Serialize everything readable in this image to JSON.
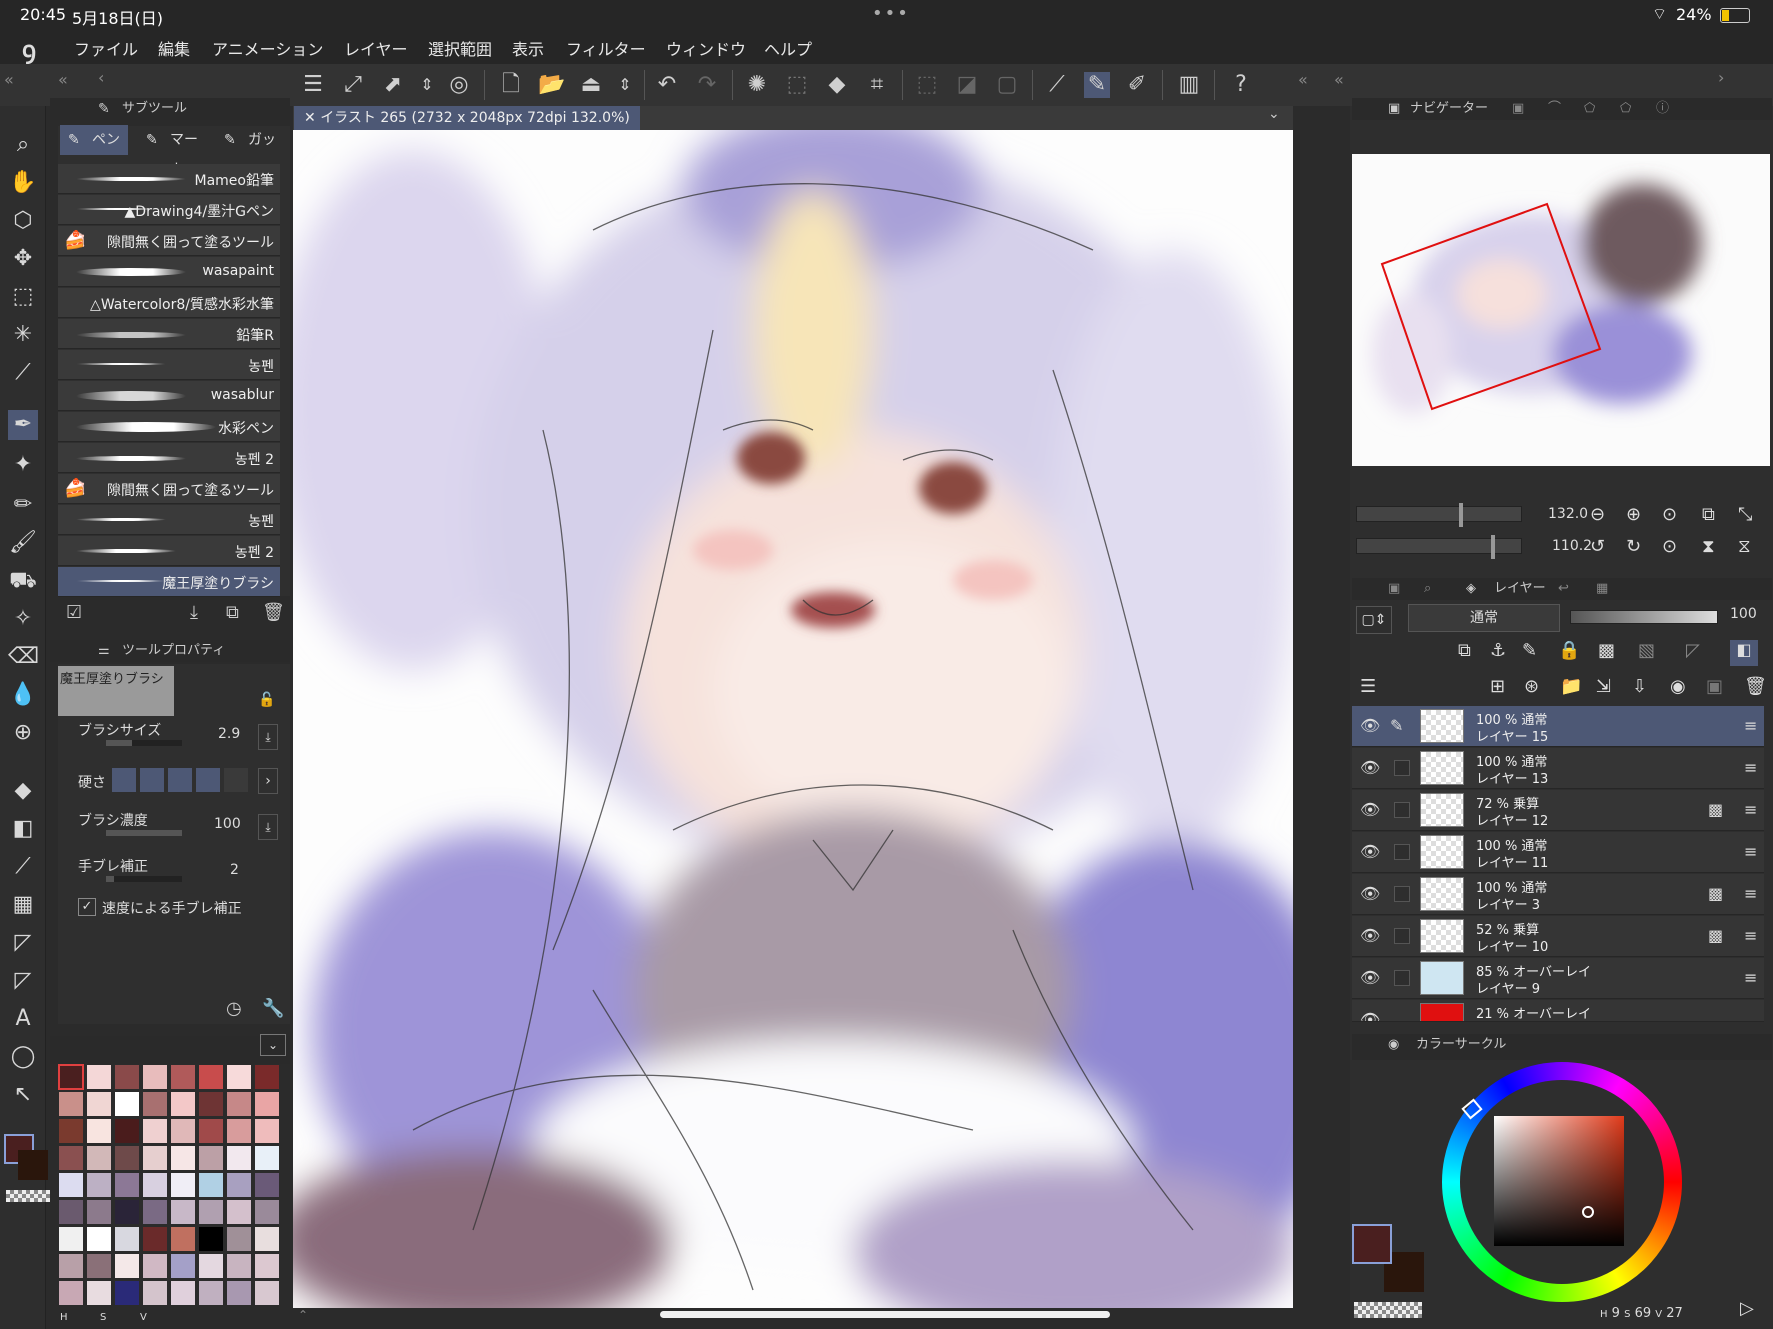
{
  "status": {
    "time": "20:45",
    "date": "5月18日(日)",
    "battery": "24%",
    "dots": "•••"
  },
  "menu": [
    "ファイル",
    "編集",
    "アニメーション",
    "レイヤー",
    "選択範囲",
    "表示",
    "フィルター",
    "ウィンドウ",
    "ヘルプ"
  ],
  "document_tab": "イラスト 265 (2732 x 2048px 72dpi 132.0%)",
  "subtool_panel": {
    "title": "サブツール",
    "tabs": [
      "ペン",
      "マーカ",
      "ガッシ"
    ],
    "brushes": [
      "Mameo鉛筆",
      "▲Drawing4/墨汁Gペン",
      "隙間無く囲って塗るツール",
      "wasapaint",
      "△Watercolor8/質感水彩水筆",
      "鉛筆R",
      "농펜",
      "wasablur",
      "水彩ペン",
      "농펜 2",
      "隙間無く囲って塗るツール",
      "농펜",
      "농펜 2",
      "魔王厚塗りブラシ"
    ]
  },
  "tool_property": {
    "title": "ツールプロパティ",
    "preset": "魔王厚塗りブラシ",
    "brush_size_label": "ブラシサイズ",
    "brush_size": "2.9",
    "hardness_label": "硬さ",
    "density_label": "ブラシ濃度",
    "density": "100",
    "stabilization_label": "手ブレ補正",
    "stabilization": "2",
    "speed_stab_label": "速度による手ブレ補正"
  },
  "palette_footer": [
    "H",
    "S",
    "V"
  ],
  "palette_colors": [
    "#4a1f1f",
    "#f4d7d7",
    "#8a4a4a",
    "#e8bcbc",
    "#b05a5a",
    "#c84c4c",
    "#f7dada",
    "#7a2a2a",
    "#c9908a",
    "#f0d6d3",
    "#ffffff",
    "#a87070",
    "#f3c8c8",
    "#6e3434",
    "#c68888",
    "#e9a5a5",
    "#7a3a2e",
    "#f8e4e0",
    "#4a1c1c",
    "#efd0d0",
    "#e0b8b8",
    "#a04a4a",
    "#d89c9c",
    "#efbcbc",
    "#8a5050",
    "#d2b8b8",
    "#6e4a4a",
    "#e6cfcf",
    "#f6e6e6",
    "#bca0a6",
    "#f2e8ee",
    "#e8f0f8",
    "#dcdcf0",
    "#bcb0c4",
    "#8c7896",
    "#d8d0e0",
    "#f0eef6",
    "#b0d0e4",
    "#a8a0c0",
    "#6a5a78",
    "#6a5a6e",
    "#8c7a8c",
    "#2a2438",
    "#7a6a84",
    "#c8b8c8",
    "#b0a0b0",
    "#d4c0cc",
    "#9a8a9a",
    "#f0f0f0",
    "#ffffff",
    "#d8d8e0",
    "#6a2a2a",
    "#c07060",
    "#000000",
    "#a09098",
    "#e8dede",
    "#b8a0a8",
    "#8a7078",
    "#f4e8e8",
    "#d0b8c4",
    "#a4a0c8",
    "#e4d8e0",
    "#c8b4c0",
    "#dcc8d0",
    "#c8a8b4",
    "#e8dce0",
    "#2a2a78",
    "#d4c4cc",
    "#e0d0dc",
    "#c0b0c0",
    "#a898b0",
    "#d8c8d0"
  ],
  "navigator": {
    "title": "ナビゲーター",
    "zoom": "132.0",
    "rotation": "110.2"
  },
  "layer_panel": {
    "title": "レイヤー",
    "blend_mode": "通常",
    "opacity": "100",
    "layers": [
      {
        "mode": "100 % 通常",
        "name": "レイヤー 15"
      },
      {
        "mode": "100 % 通常",
        "name": "レイヤー 13"
      },
      {
        "mode": "72 % 乗算",
        "name": "レイヤー 12"
      },
      {
        "mode": "100 % 通常",
        "name": "レイヤー 11"
      },
      {
        "mode": "100 % 通常",
        "name": "レイヤー 3"
      },
      {
        "mode": "52 % 乗算",
        "name": "レイヤー 10"
      },
      {
        "mode": "85 % オーバーレイ",
        "name": "レイヤー 9"
      },
      {
        "mode": "21 % オーバーレイ",
        "name": ""
      }
    ]
  },
  "color_circle": {
    "title": "カラーサークル",
    "readout": {
      "h_label": "H",
      "h": "9",
      "s_label": "S",
      "s": "69",
      "v_label": "V",
      "v": "27"
    }
  },
  "colors": {
    "main": "#4a1f1f",
    "sub": "#2a160c",
    "accent": "#4d5875"
  }
}
